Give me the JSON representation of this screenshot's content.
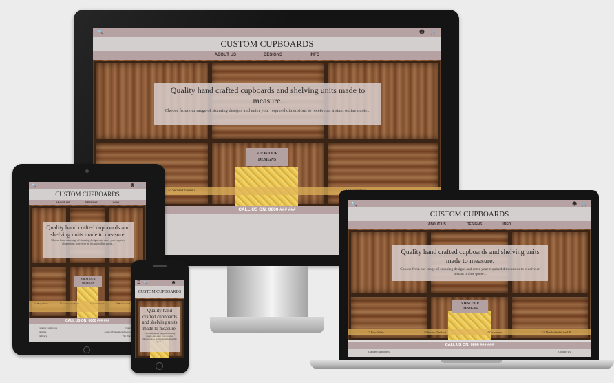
{
  "site": {
    "brand": "CUSTOM CUPBOARDS",
    "nav": [
      "ABOUT US",
      "DESIGNS",
      "INFO"
    ],
    "hero_heading": "Quality hand crafted cupboards and shelving units made to measure.",
    "hero_text": "Choose from our range of stunning designs and enter your required dimensions to receive an instant online quote...",
    "cta_label": "VIEW OUR DESIGNS",
    "features": [
      "Buy Online",
      "Secure Checkout",
      "Guaranteed",
      "Handcrafted in the UK"
    ],
    "call_label": "CALL US ON: 0800 ### ###",
    "footer_left": "Custom Cupboards",
    "footer_left_2": "Designs",
    "footer_left_3": "Delivery",
    "footer_right": "Contact Us",
    "footer_right_2": "contact@customcupboards.co.uk",
    "footer_right_3": "The Workshop"
  },
  "icons": {
    "search": "search-icon",
    "user": "user-icon",
    "cart": "cart-icon",
    "menu": "hamburger-menu-icon",
    "check": "check-circle-icon"
  },
  "colors": {
    "background": "#ececec",
    "header": "#b6a2a2",
    "title_bar": "#d3cfcf",
    "device_frame": "#141414",
    "strip": "#e0b45a"
  }
}
